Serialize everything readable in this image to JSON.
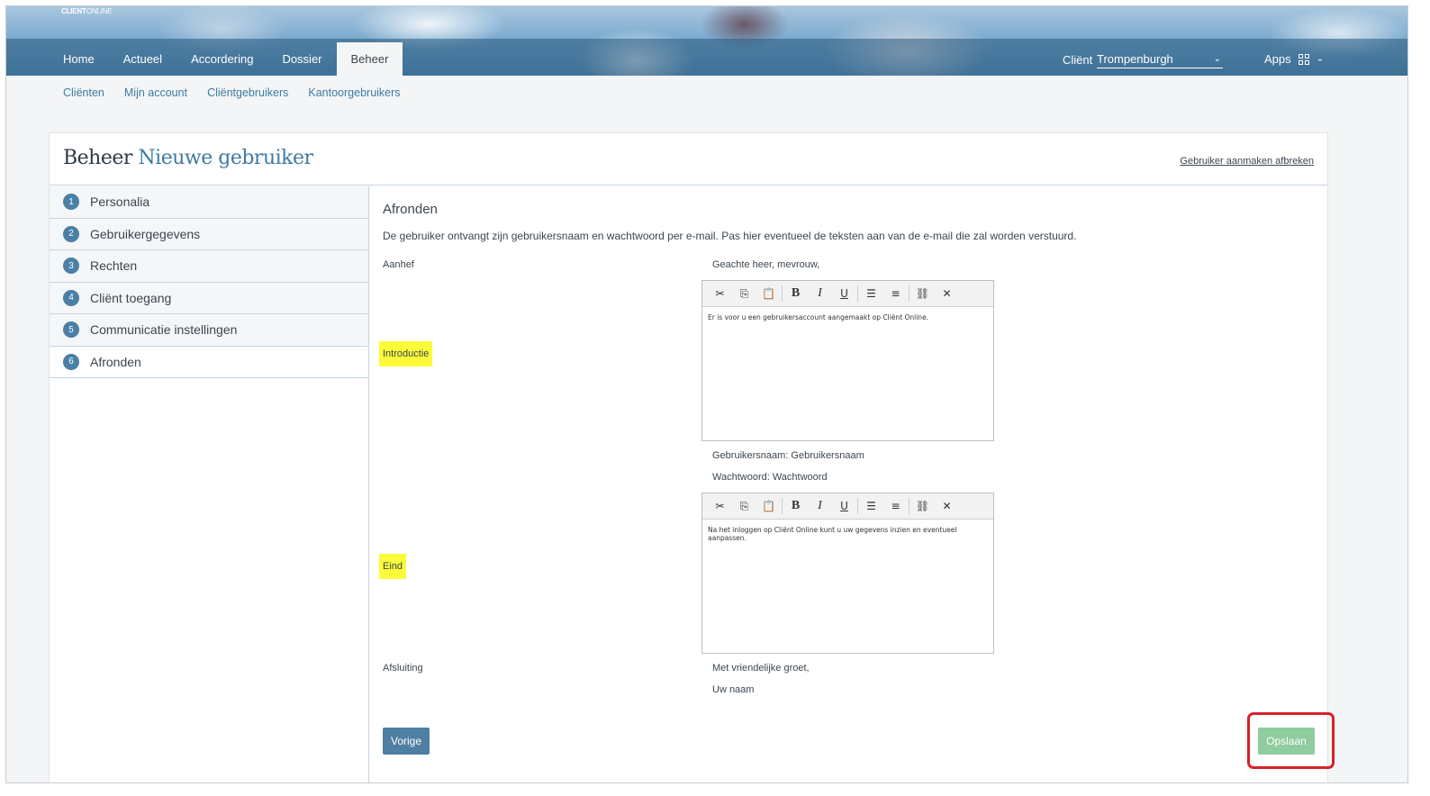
{
  "app": {
    "logo_bold": "CLIENT",
    "logo_light": "ONLINE"
  },
  "nav": {
    "items": [
      {
        "label": "Home"
      },
      {
        "label": "Actueel"
      },
      {
        "label": "Accordering"
      },
      {
        "label": "Dossier"
      },
      {
        "label": "Beheer"
      }
    ],
    "active": "Beheer"
  },
  "client": {
    "label": "Cliënt",
    "selected": "Trompenburgh"
  },
  "apps": {
    "label": "Apps"
  },
  "subnav": [
    {
      "label": "Cliënten"
    },
    {
      "label": "Mijn account"
    },
    {
      "label": "Cliëntgebruikers"
    },
    {
      "label": "Kantoorgebruikers"
    }
  ],
  "page": {
    "title_prefix": "Beheer",
    "title_accent": "Nieuwe gebruiker",
    "abort_link": "Gebruiker aanmaken afbreken"
  },
  "steps": [
    {
      "num": "1",
      "label": "Personalia"
    },
    {
      "num": "2",
      "label": "Gebruikergegevens"
    },
    {
      "num": "3",
      "label": "Rechten"
    },
    {
      "num": "4",
      "label": "Cliënt toegang"
    },
    {
      "num": "5",
      "label": "Communicatie instellingen"
    },
    {
      "num": "6",
      "label": "Afronden"
    }
  ],
  "active_step": "Afronden",
  "form": {
    "section_title": "Afronden",
    "intro": "De gebruiker ontvangt zijn gebruikersnaam en wachtwoord per e-mail. Pas hier eventueel de teksten aan van de e-mail die zal worden verstuurd.",
    "aanhef_label": "Aanhef",
    "aanhef_value": "Geachte heer, mevrouw,",
    "introductie_label": "Introductie",
    "introductie_text": "Er is voor u een gebruikersaccount aangemaakt op Cliënt Online.",
    "username_line": "Gebruikersnaam: Gebruikersnaam",
    "password_line": "Wachtwoord: Wachtwoord",
    "eind_label": "Eind",
    "eind_text": "Na het inloggen op Cliënt Online kunt u uw gegevens inzien en eventueel aanpassen.",
    "afsluiting_label": "Afsluiting",
    "afsluiting_line1": "Met vriendelijke groet,",
    "afsluiting_line2": "Uw naam"
  },
  "toolbar_icons": [
    "cut-icon",
    "copy-icon",
    "paste-icon",
    "bold-icon",
    "italic-icon",
    "underline-icon",
    "bullet-list-icon",
    "numbered-list-icon",
    "link-icon",
    "unlink-icon"
  ],
  "toolbar_glyphs": {
    "bold": "B",
    "italic": "I",
    "underline": "U"
  },
  "buttons": {
    "prev": "Vorige",
    "save": "Opslaan"
  },
  "colors": {
    "accent": "#3d7aa4",
    "step_badge": "#4a7fa6",
    "save_button": "#8fcc9e",
    "highlight": "#fbfb3a",
    "annotation_box": "#d9202a"
  }
}
